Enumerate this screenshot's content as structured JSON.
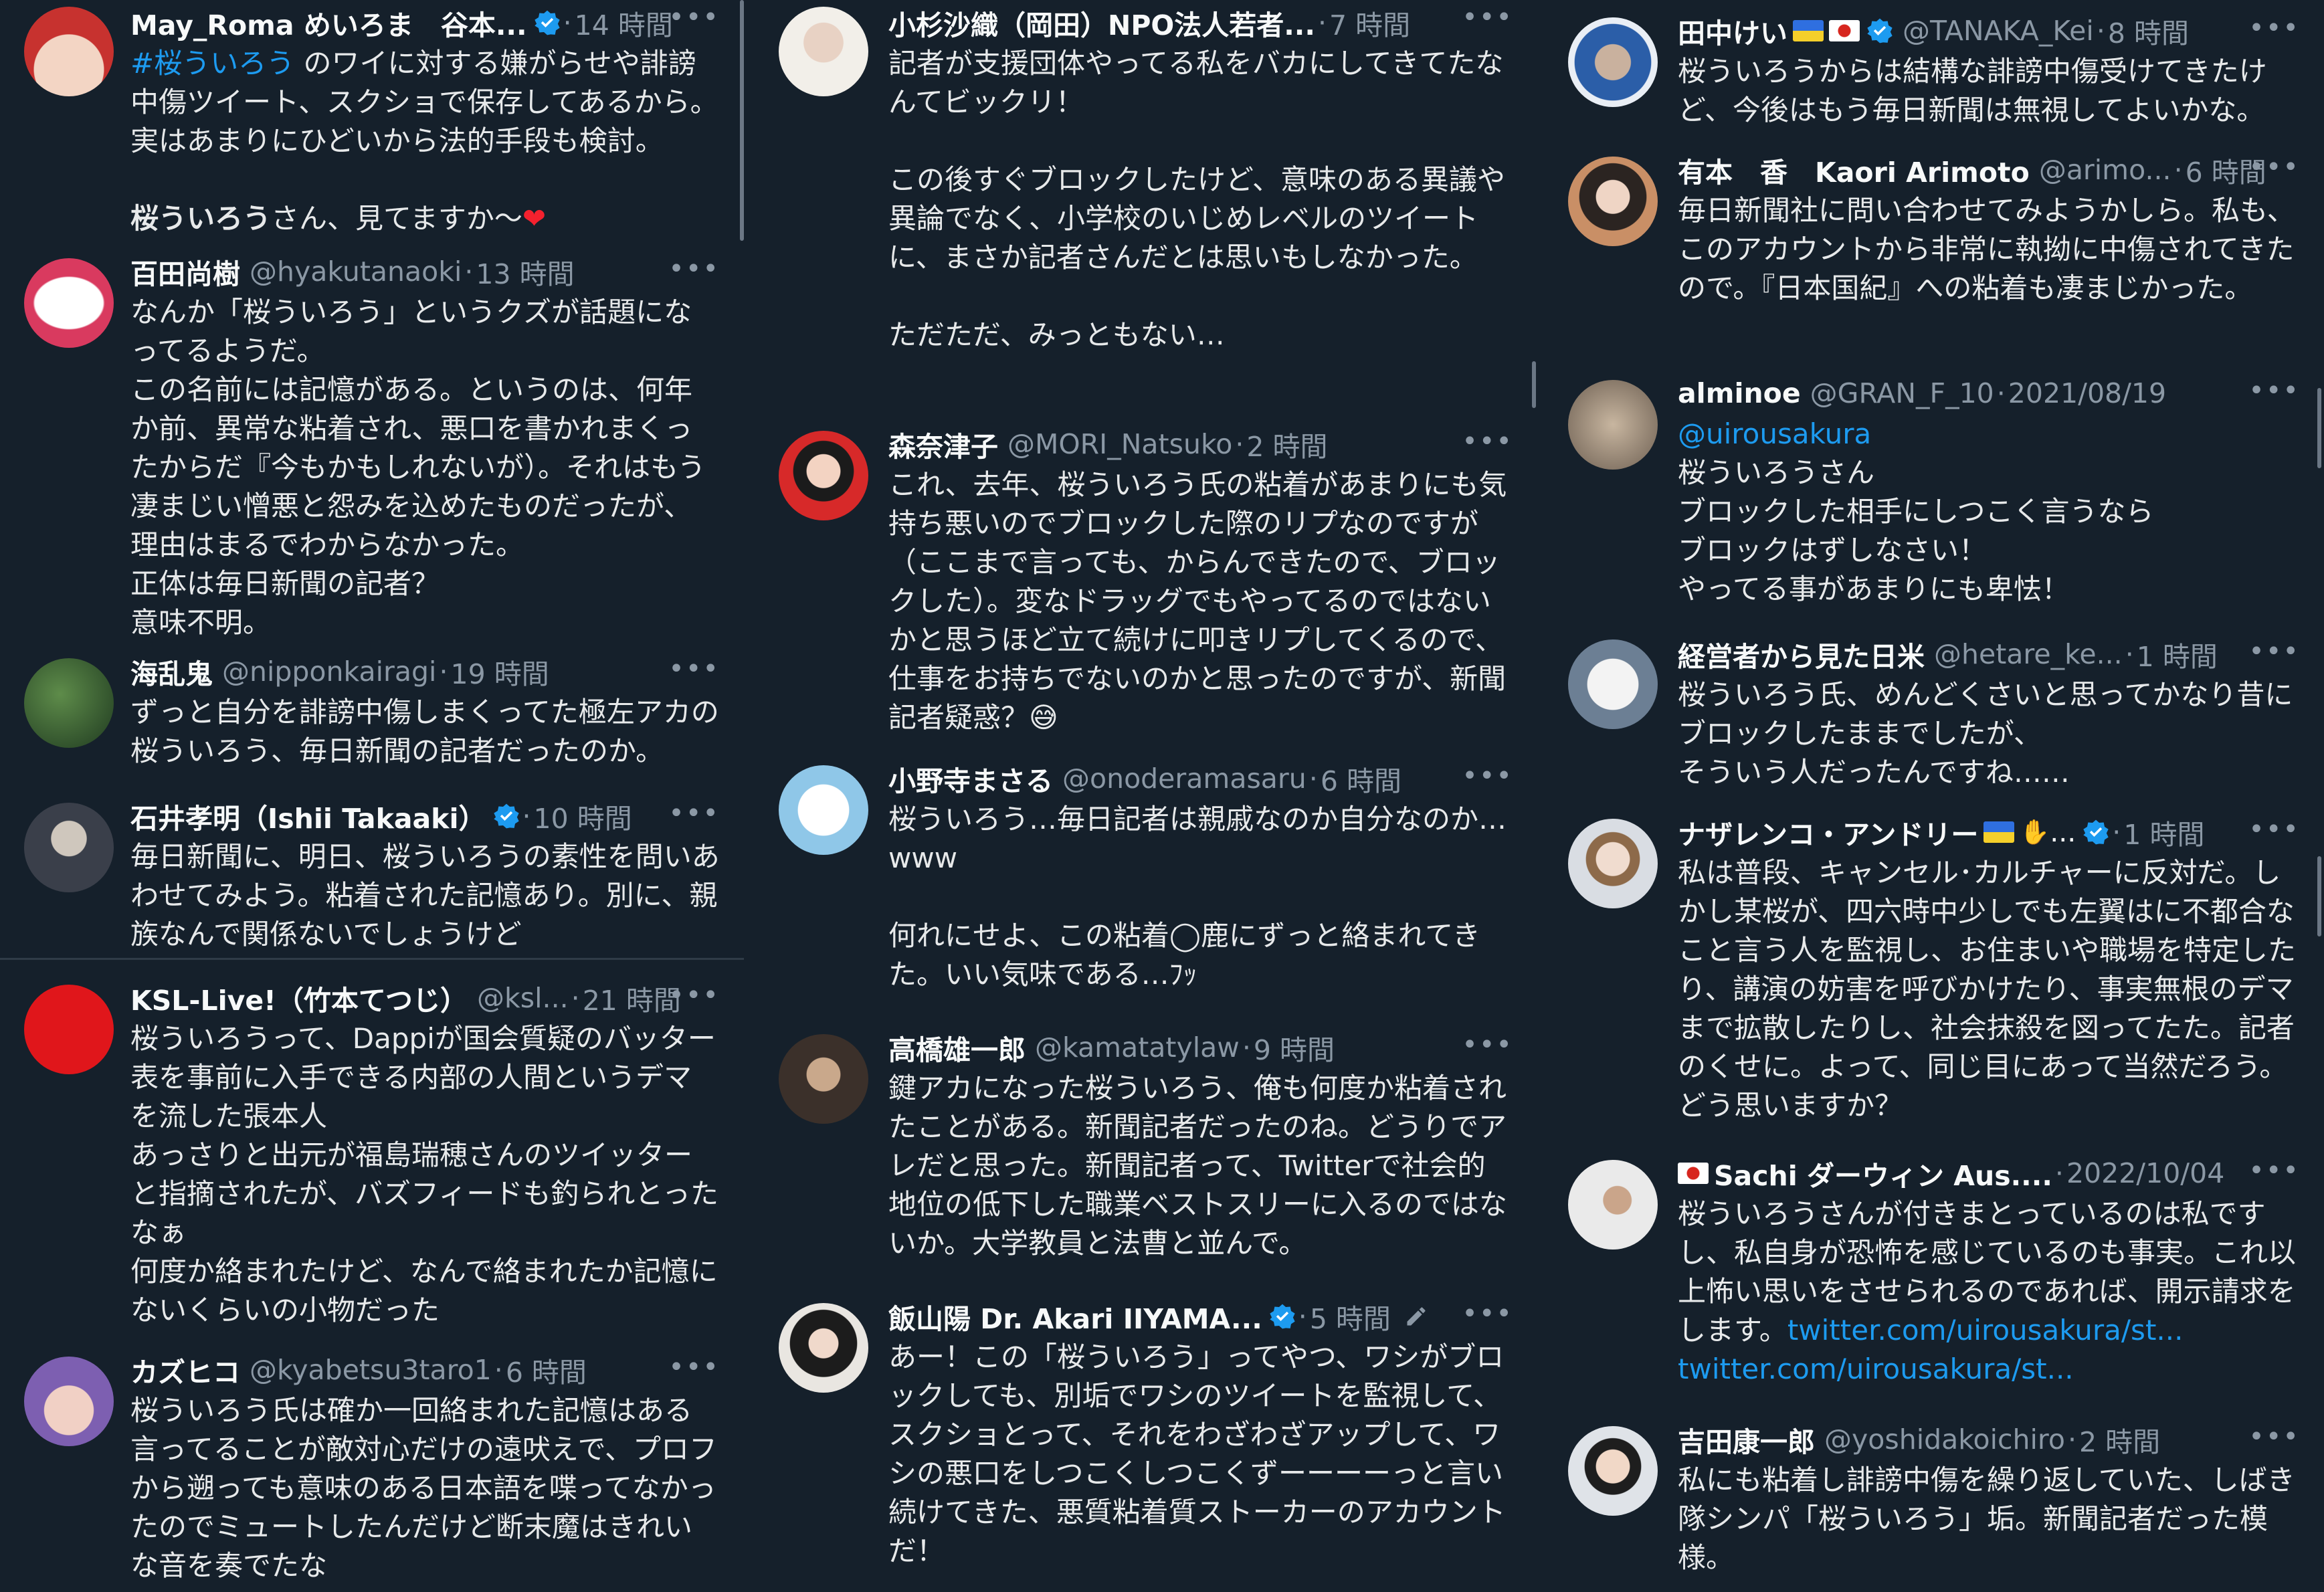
{
  "columns": [
    {
      "tweets": [
        {
          "name": "May_Roma めいろま　谷本...",
          "handle": "",
          "time": "14 時間",
          "body_parts": [
            {
              "text": "#桜ういろう",
              "style": "mention"
            },
            {
              "text": " のワイに対する嫌がらせや誹謗中傷ツイート、スクショで保存してあるから。実はあまりにひどいから法的手段も検討。\n\n",
              "style": ""
            },
            {
              "text": "桜ういろう",
              "style": "b"
            },
            {
              "text": "さん、見てますか〜",
              "style": ""
            },
            {
              "text": "❤",
              "style": "heart"
            }
          ],
          "verified": true
        },
        {
          "name": "百田尚樹",
          "handle": "@hyakutanaoki",
          "time": "13 時間",
          "body": "なんか「桜ういろう」というクズが話題になってるようだ。\nこの名前には記憶がある。というのは、何年か前、異常な粘着され、悪口を書かれまくったからだ『今もかもしれないが）。それはもう凄まじい憎悪と怨みを込めたものだったが、理由はまるでわからなかった。\n正体は毎日新聞の記者？\n意味不明。"
        },
        {
          "name": "海乱鬼",
          "handle": "@nipponkairagi",
          "time": "19 時間",
          "body": "ずっと自分を誹謗中傷しまくってた極左アカの桜ういろう、毎日新聞の記者だったのか。"
        },
        {
          "name": "石井孝明（Ishii Takaaki）",
          "handle": "",
          "time": "10 時間",
          "verified": true,
          "body": "毎日新聞に、明日、桜ういろうの素性を問いあわせてみよう。粘着された記憶あり。別に、親族なんで関係ないでしょうけど"
        },
        {
          "name": "KSL-Live!（竹本てつじ）",
          "handle": "@ksl...",
          "time": "21 時間",
          "body": "桜ういろうって、Dappiが国会質疑のバッター表を事前に入手できる内部の人間というデマを流した張本人\nあっさりと出元が福島瑞穂さんのツイッターと指摘されたが、バズフィードも釣られとったなぁ\n何度か絡まれたけど、なんで絡まれたか記憶にないくらいの小物だった"
        },
        {
          "name": "カズヒコ",
          "handle": "@kyabetsu3taro1",
          "time": "6 時間",
          "body": "桜ういろう氏は確か一回絡まれた記憶はある\n言ってることが敵対心だけの遠吠えで、プロフから遡っても意味のある日本語を喋ってなかったのでミュートしたんだけど断末魔はきれいな音を奏でたな"
        }
      ]
    },
    {
      "tweets": [
        {
          "name": "小杉沙織（岡田）NPO法人若者...",
          "handle": "",
          "time": "7 時間",
          "body": "記者が支援団体やってる私をバカにしてきてたなんてビックリ！\n\nこの後すぐブロックしたけど、意味のある異議や異論でなく、小学校のいじめレベルのツイートに、まさか記者さんだとは思いもしなかった。\n\nただただ、みっともない…"
        },
        {
          "name": "森奈津子",
          "handle": "@MORI_Natsuko",
          "time": "2 時間",
          "body": "これ、去年、桜ういろう氏の粘着があまりにも気持ち悪いのでブロックした際のリプなのですが（ここまで言っても、からんできたので、ブロックした）。変なドラッグでもやってるのではないかと思うほど立て続けに叩きリプしてくるので、仕事をお持ちでないのかと思ったのですが、新聞記者疑惑？😅"
        },
        {
          "name": "小野寺まさる",
          "handle": "@onoderamasaru",
          "time": "6 時間",
          "body": "桜ういろう…毎日記者は親戚なのか自分なのか…www\n\n何れにせよ、この粘着◯鹿にずっと絡まれてきた。いい気味である…ﾌｯ"
        },
        {
          "name": "高橋雄一郎",
          "handle": "@kamatatylaw",
          "time": "9 時間",
          "body": "鍵アカになった桜ういろう、俺も何度か粘着されたことがある。新聞記者だったのね。どうりでアレだと思った。新聞記者って、Twitterで社会的地位の低下した職業ベストスリーに入るのではないか。大学教員と法曹と並んで。"
        },
        {
          "name": "飯山陽 Dr. Akari IIYAMA...",
          "handle": "",
          "time": "5 時間",
          "verified": true,
          "pencil": true,
          "body": "あー！この「桜ういろう」ってやつ、ワシがブロックしても、別垢でワシのツイートを監視して、スクショとって、それをわざわざアップして、ワシの悪口をしつこくしつこくずーーーーっと言い続けてきた、悪質粘着質ストーカーのアカウントだ！"
        }
      ]
    },
    {
      "tweets": [
        {
          "name": "田中けい",
          "handle": "@TANAKA_Kei",
          "time": "8 時間",
          "flags": [
            "ua",
            "jp"
          ],
          "verified": true,
          "body": "桜ういろうからは結構な誹謗中傷受けてきたけど、今後はもう毎日新聞は無視してよいかな。"
        },
        {
          "name": "有本　香　Kaori Arimoto",
          "handle": "@arimo...",
          "time": "6 時間",
          "body": "毎日新聞社に問い合わせてみようかしら。私も、このアカウントから非常に執拗に中傷されてきたので。『日本国紀』への粘着も凄まじかった。"
        },
        {
          "name": "alminoe",
          "handle": "@GRAN_F_10",
          "time": "2021/08/19",
          "body_parts": [
            {
              "text": "@uirousakura",
              "style": "mention"
            },
            {
              "text": "\n桜ういろうさん\nブロックした相手にしつこく言うなら\nブロックはずしなさい！\nやってる事があまりにも卑怯！",
              "style": ""
            }
          ]
        },
        {
          "name": "経営者から見た日米",
          "handle": "@hetare_ke...",
          "time": "1 時間",
          "body": "桜ういろう氏、めんどくさいと思ってかなり昔にブロックしたままでしたが、\nそういう人だったんですね……"
        },
        {
          "name": "ナザレンコ・アンドリー",
          "handle": "",
          "time": "1 時間",
          "flags": [
            "ua"
          ],
          "handshake": true,
          "verified": true,
          "body": "私は普段、キャンセル･カルチャーに反対だ。しかし某桜が、四六時中少しでも左翼はに不都合なこと言う人を監視し、お住まいや職場を特定したり、講演の妨害を呼びかけたり、事実無根のデマまで拡散したりし、社会抹殺を図ってたた。記者のくせに。よって、同じ目にあって当然だろう。どう思いますか？"
        },
        {
          "name": "Sachi ダーウィン Aus....",
          "handle": "",
          "time": "2022/10/04",
          "flag_prefix": "jp",
          "body_parts": [
            {
              "text": "桜ういろうさんが付きまとっているのは私ですし、私自身が恐怖を感じているのも事実。これ以上怖い思いをさせられるのであれば、開示請求をします。",
              "style": ""
            },
            {
              "text": "twitter.com/uirousakura/st...\ntwitter.com/uirousakura/st...",
              "style": "link"
            }
          ]
        },
        {
          "name": "吉田康一郎",
          "handle": "@yoshidakoichiro",
          "time": "2 時間",
          "body": "私にも粘着し誹謗中傷を繰り返していた、しばき隊シンパ「桜ういろう」垢。新聞記者だった模様。"
        }
      ]
    }
  ],
  "more_label": "•••",
  "colors": {
    "background": "#15202b",
    "text": "#e7e9ea",
    "muted": "#8b98a5",
    "accent": "#1d9bf0"
  }
}
